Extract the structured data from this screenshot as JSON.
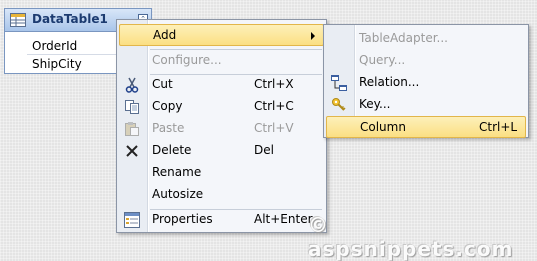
{
  "datatable": {
    "title": "DataTable1",
    "columns": [
      "OrderId",
      "ShipCity"
    ]
  },
  "context_menu": {
    "items": [
      {
        "label": "Add",
        "shortcut": "",
        "enabled": true,
        "highlighted": true,
        "submenu": true,
        "icon": ""
      },
      {
        "label": "Configure...",
        "shortcut": "",
        "enabled": false,
        "icon": ""
      },
      {
        "label": "Cut",
        "shortcut": "Ctrl+X",
        "enabled": true,
        "icon": "scissors-icon"
      },
      {
        "label": "Copy",
        "shortcut": "Ctrl+C",
        "enabled": true,
        "icon": "copy-icon"
      },
      {
        "label": "Paste",
        "shortcut": "Ctrl+V",
        "enabled": false,
        "icon": "paste-icon"
      },
      {
        "label": "Delete",
        "shortcut": "Del",
        "enabled": true,
        "icon": "delete-x-icon"
      },
      {
        "label": "Rename",
        "shortcut": "",
        "enabled": true,
        "icon": ""
      },
      {
        "label": "Autosize",
        "shortcut": "",
        "enabled": true,
        "icon": ""
      },
      {
        "label": "Properties",
        "shortcut": "Alt+Enter",
        "enabled": true,
        "icon": "properties-icon"
      }
    ]
  },
  "add_submenu": {
    "items": [
      {
        "label": "TableAdapter...",
        "shortcut": "",
        "enabled": false,
        "icon": ""
      },
      {
        "label": "Query...",
        "shortcut": "",
        "enabled": false,
        "icon": ""
      },
      {
        "label": "Relation...",
        "shortcut": "",
        "enabled": true,
        "icon": "relation-icon"
      },
      {
        "label": "Key...",
        "shortcut": "",
        "enabled": true,
        "icon": "key-icon"
      },
      {
        "label": "Column",
        "shortcut": "Ctrl+L",
        "enabled": true,
        "highlighted": true,
        "icon": ""
      }
    ]
  },
  "watermark": "© aspsnippets.com",
  "colors": {
    "highlight_top": "#fdf0b9",
    "highlight_bottom": "#fbdf83",
    "highlight_border": "#e2b64a",
    "menu_bg": "#f4f6fa",
    "header_blue": "#a9c5ea"
  }
}
